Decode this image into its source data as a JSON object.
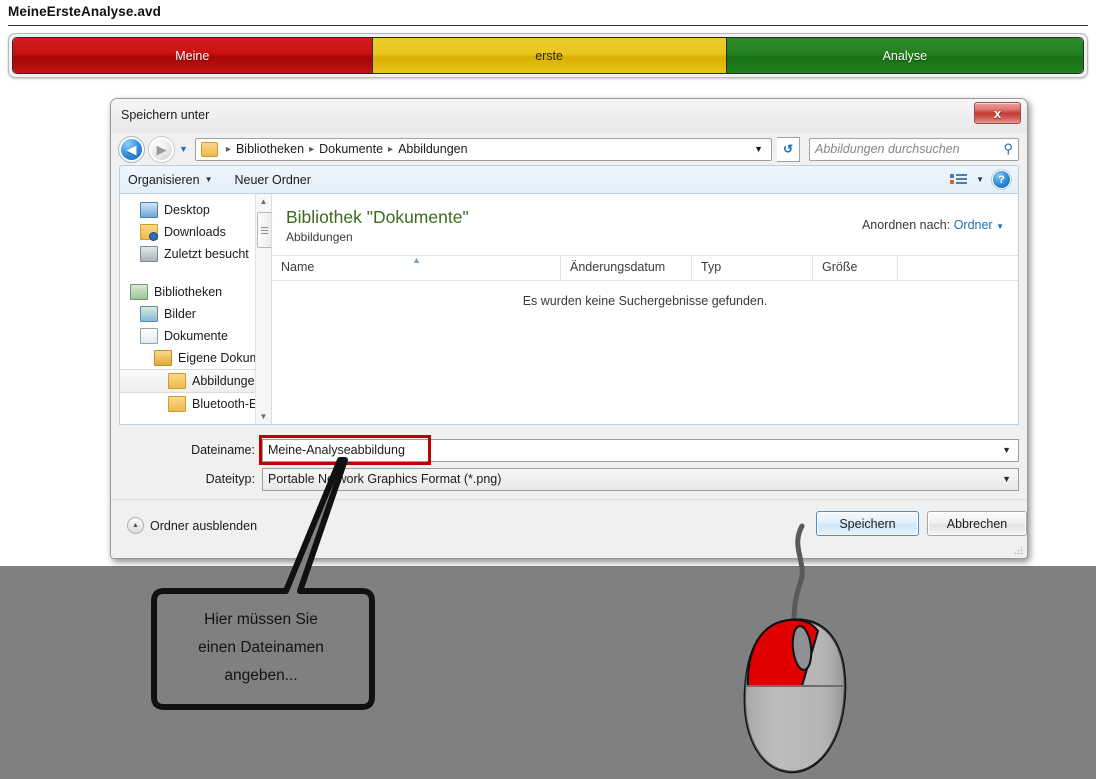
{
  "document": {
    "title": "MeineErsteAnalyse.avd",
    "bar_segments": [
      {
        "label": "Meine",
        "color": "#c31212"
      },
      {
        "label": "erste",
        "color": "#e8c41c"
      },
      {
        "label": "Analyse",
        "color": "#218020"
      }
    ]
  },
  "dialog": {
    "title": "Speichern unter",
    "close_label": "x",
    "nav": {
      "back_glyph": "◀",
      "forward_glyph": "▶",
      "recent_caret": "▼",
      "breadcrumb": [
        "Bibliotheken",
        "Dokumente",
        "Abbildungen"
      ],
      "breadcrumb_sep": "▸",
      "breadcrumb_caret": "▼",
      "refresh_glyph": "↺",
      "search_placeholder": "Abbildungen durchsuchen",
      "search_icon": "⚲"
    },
    "toolbar": {
      "organize_label": "Organisieren",
      "organize_caret": "▼",
      "new_folder_label": "Neuer Ordner",
      "view_caret": "▼",
      "help_label": "?"
    },
    "tree": [
      {
        "label": "Desktop",
        "icon": "monitor-icon",
        "indent": 1
      },
      {
        "label": "Downloads",
        "icon": "folder-download-icon",
        "indent": 1
      },
      {
        "label": "Zuletzt besucht",
        "icon": "recent-places-icon",
        "indent": 1
      },
      {
        "label": "Bibliotheken",
        "icon": "libraries-icon",
        "indent": 0
      },
      {
        "label": "Bilder",
        "icon": "pictures-icon",
        "indent": 1
      },
      {
        "label": "Dokumente",
        "icon": "documents-icon",
        "indent": 1
      },
      {
        "label": "Eigene Dokum‹",
        "icon": "my-documents-icon",
        "indent": 2
      },
      {
        "label": "Abbildungen",
        "icon": "folder-icon",
        "indent": 3,
        "selected": true
      },
      {
        "label": "Bluetooth-Ex",
        "icon": "folder-icon",
        "indent": 3
      }
    ],
    "library": {
      "title": "Bibliothek \"Dokumente\"",
      "subtitle": "Abbildungen",
      "arrange_label": "Anordnen nach:",
      "arrange_value": "Ordner",
      "arrange_caret": "▼",
      "columns": [
        "Name",
        "Änderungsdatum",
        "Typ",
        "Größe",
        ""
      ],
      "sort_glyph": "▲",
      "empty_message": "Es wurden keine Suchergebnisse gefunden."
    },
    "fields": {
      "filename_label": "Dateiname:",
      "filename_value": "Meine-Analyseabbildung",
      "filename_caret": "▼",
      "filetype_label": "Dateityp:",
      "filetype_value": "Portable Network Graphics Format (*.png)",
      "filetype_caret": "▼",
      "highlight_color": "#c00000"
    },
    "footer": {
      "hide_folders_label": "Ordner ausblenden",
      "hide_folders_caret": "▲",
      "save_label": "Speichern",
      "cancel_label": "Abbrechen"
    }
  },
  "annotation": {
    "callout_lines": [
      "Hier müssen Sie",
      "einen Dateinamen",
      "angeben..."
    ],
    "mouse_button_color": "#e00000"
  }
}
